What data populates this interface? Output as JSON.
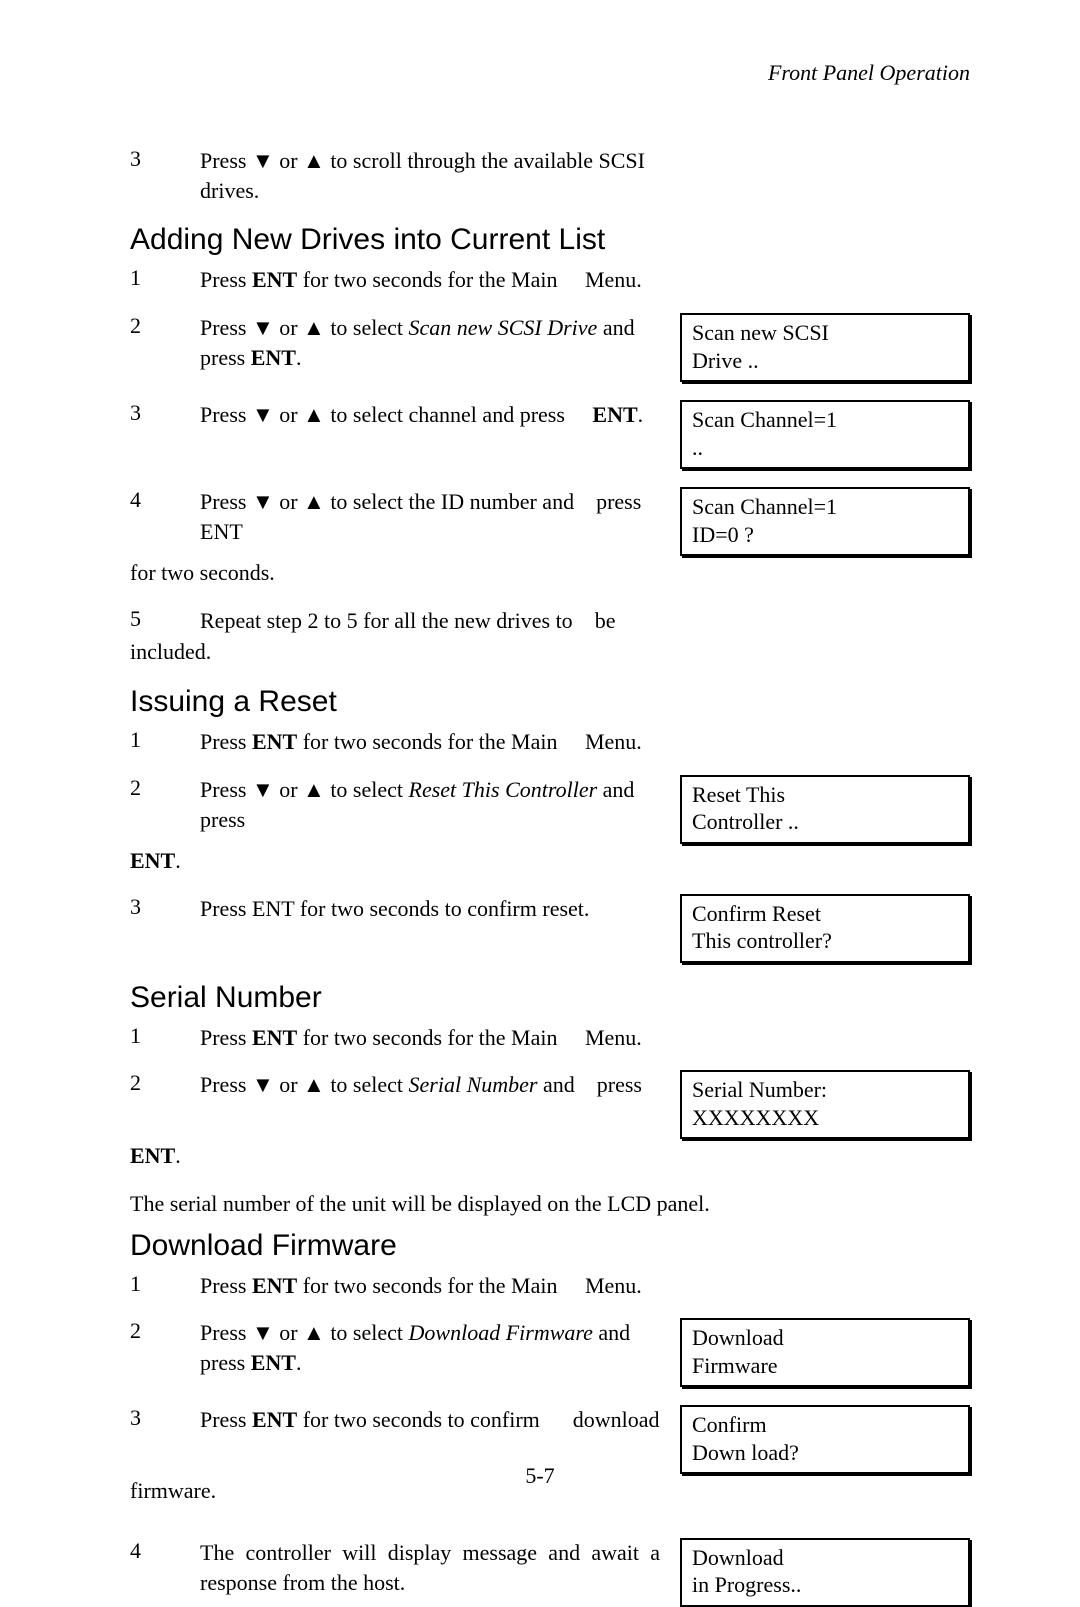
{
  "header": {
    "title": "Front Panel Operation"
  },
  "intro": {
    "step3": {
      "num": "3",
      "text_before": "Press ▼ or ▲ to scroll through the available SCSI drives."
    }
  },
  "section_adding": {
    "title": "Adding New Drives into Current List",
    "steps": {
      "s1": {
        "num": "1",
        "t1": "Press ",
        "ent": "ENT",
        "t2": " for two seconds for the Main",
        "tail": "Menu."
      },
      "s2": {
        "num": "2",
        "t1": "Press ▼ or ▲ to select ",
        "it": "Scan new SCSI Drive",
        "t2": " and press ",
        "ent": "ENT",
        "t3": ".",
        "lcd_l1": "Scan new SCSI",
        "lcd_l2": "Drive           .."
      },
      "s3": {
        "num": "3",
        "t1": "Press ▼ or ▲ to select channel and press",
        "ent": "ENT",
        "t2": ".",
        "lcd_l1": "Scan Channel=1",
        "lcd_l2": "                .."
      },
      "s4": {
        "num": "4",
        "t1": "Press ▼ or ▲ to select the ID number and",
        "tail": "press ENT",
        "cont": "for two seconds.",
        "lcd_l1": "Scan Channel=1",
        "lcd_l2": "ID=0            ?"
      },
      "s5": {
        "num": "5",
        "t1": "Repeat step 2 to 5 for all the new drives to",
        "tail": "be",
        "cont": "included."
      }
    }
  },
  "section_reset": {
    "title": "Issuing a Reset",
    "steps": {
      "s1": {
        "num": "1",
        "t1": "Press ",
        "ent": "ENT",
        "t2": " for two seconds for the Main",
        "tail": "Menu."
      },
      "s2": {
        "num": "2",
        "t1": "Press ▼ or ▲ to select ",
        "it": "Reset This Controller",
        "t2": " and press",
        "cont_ent": "ENT",
        "cont_t": ".",
        "lcd_l1": "Reset This",
        "lcd_l2": "Controller   .."
      },
      "s3": {
        "num": "3",
        "t1": "Press ENT for two seconds to confirm reset.",
        "lcd_l1": "Confirm Reset",
        "lcd_l2": "This controller?"
      }
    }
  },
  "section_serial": {
    "title": "Serial Number",
    "steps": {
      "s1": {
        "num": "1",
        "t1": "Press ",
        "ent": "ENT",
        "t2": " for two seconds for the Main",
        "tail": "Menu."
      },
      "s2": {
        "num": "2",
        "t1": "Press ▼ or ▲ to select ",
        "it": "Serial Number",
        "t2": " and",
        "tail": "press",
        "cont_ent": "ENT",
        "cont_t": ".",
        "lcd_l1": "Serial Number:",
        "lcd_l2": "        XXXXXXXX"
      }
    },
    "note": "The serial number of the unit will be displayed on the LCD panel."
  },
  "section_download": {
    "title": "Download Firmware",
    "steps": {
      "s1": {
        "num": "1",
        "t1": "Press ",
        "ent": "ENT",
        "t2": " for two seconds for the Main",
        "tail": "Menu."
      },
      "s2": {
        "num": "2",
        "t1": "Press ▼ or ▲ to select ",
        "it": "Download Firmware",
        "t2": " and press ",
        "ent": "ENT",
        "t3": ".",
        "lcd_l1": "Download",
        "lcd_l2": "Firmware"
      },
      "s3": {
        "num": "3",
        "t1": "Press ",
        "ent": "ENT",
        "t2": " for two seconds to confirm",
        "tail": "download",
        "cont": "firmware.",
        "lcd_l1": "Confirm",
        "lcd_l2": "Down load?"
      },
      "s4": {
        "num": "4",
        "t1": "The controller will display message and  await a response from the host.",
        "lcd_l1": "Download",
        "lcd_l2": "in Progress.."
      }
    }
  },
  "footer": {
    "page": "5-7"
  }
}
